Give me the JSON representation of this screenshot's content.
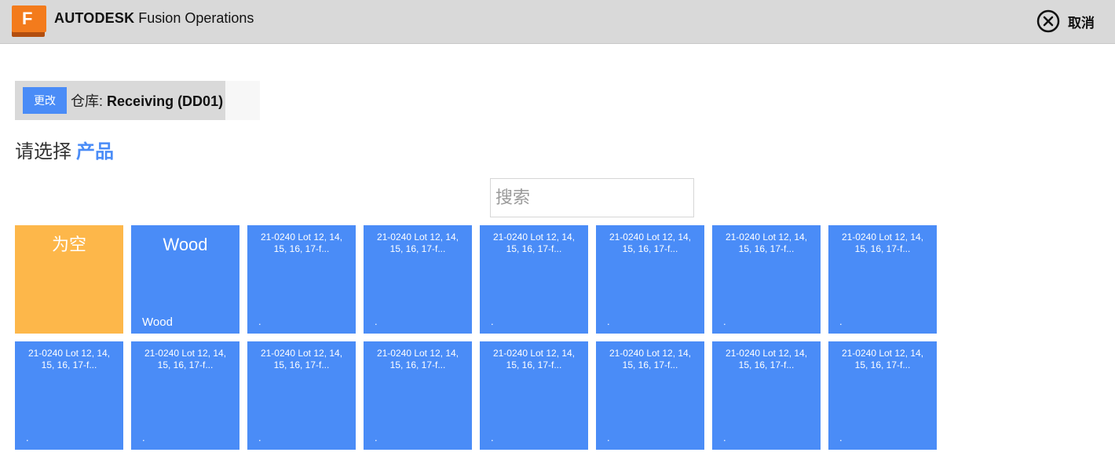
{
  "header": {
    "logo_letter": "F",
    "brand_bold": "AUTODESK",
    "brand_rest": "Fusion Operations",
    "cancel_label": "取消"
  },
  "warehouse": {
    "change_label": "更改",
    "label": "仓库:",
    "value": "Receiving (DD01)"
  },
  "prompt": {
    "text": "请选择",
    "highlight": "产品"
  },
  "search": {
    "placeholder": "搜索"
  },
  "colors": {
    "tile_blue": "#4a8cf7",
    "tile_orange": "#fdb74a",
    "header_bg": "#d9d9d9"
  },
  "products": [
    {
      "title": "为空",
      "sub": ""
    },
    {
      "title": "Wood",
      "sub": "Wood"
    },
    {
      "title": "21-0240 Lot 12, 14, 15, 16, 17-f...",
      "sub": "."
    },
    {
      "title": "21-0240 Lot 12, 14, 15, 16, 17-f...",
      "sub": "."
    },
    {
      "title": "21-0240 Lot 12, 14, 15, 16, 17-f...",
      "sub": "."
    },
    {
      "title": "21-0240 Lot 12, 14, 15, 16, 17-f...",
      "sub": "."
    },
    {
      "title": "21-0240 Lot 12, 14, 15, 16, 17-f...",
      "sub": "."
    },
    {
      "title": "21-0240 Lot 12, 14, 15, 16, 17-f...",
      "sub": "."
    },
    {
      "title": "21-0240 Lot 12, 14, 15, 16, 17-f...",
      "sub": "."
    },
    {
      "title": "21-0240 Lot 12, 14, 15, 16, 17-f...",
      "sub": "."
    },
    {
      "title": "21-0240 Lot 12, 14, 15, 16, 17-f...",
      "sub": "."
    },
    {
      "title": "21-0240 Lot 12, 14, 15, 16, 17-f...",
      "sub": "."
    },
    {
      "title": "21-0240 Lot 12, 14, 15, 16, 17-f...",
      "sub": "."
    },
    {
      "title": "21-0240 Lot 12, 14, 15, 16, 17-f...",
      "sub": "."
    },
    {
      "title": "21-0240 Lot 12, 14, 15, 16, 17-f...",
      "sub": "."
    },
    {
      "title": "21-0240 Lot 12, 14, 15, 16, 17-f...",
      "sub": "."
    }
  ]
}
